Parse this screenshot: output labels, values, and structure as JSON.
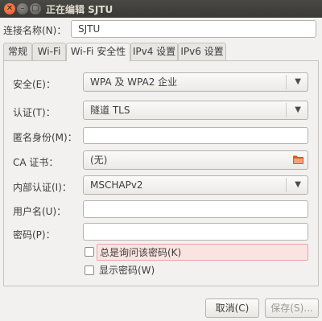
{
  "window": {
    "title": "正在编辑 SJTU",
    "close_glyph": "✕",
    "minimize_glyph": "–",
    "maximize_glyph": "▢"
  },
  "connection_name": {
    "label": "连接名称(N)：",
    "value": "SJTU"
  },
  "tabs": [
    {
      "label": "常规",
      "active": false
    },
    {
      "label": "Wi-Fi",
      "active": false
    },
    {
      "label": "Wi-Fi 安全性",
      "active": true
    },
    {
      "label": "IPv4 设置",
      "active": false
    },
    {
      "label": "IPv6 设置",
      "active": false
    }
  ],
  "security": {
    "security_label": "安全(E)：",
    "security_value": "WPA 及 WPA2 企业",
    "auth_label": "认证(T)：",
    "auth_value": "隧道 TLS",
    "anon_label": "匿名身份(M)：",
    "anon_value": "",
    "ca_label": "CA 证书：",
    "ca_value": "(无)",
    "inner_auth_label": "内部认证(I)：",
    "inner_auth_value": "MSCHAPv2",
    "username_label": "用户名(U)：",
    "username_value": "",
    "password_label": "密码(P)：",
    "password_value": "",
    "always_ask_label": "总是询问该密码(K)",
    "always_ask_checked": false,
    "show_password_label": "显示密码(W)",
    "show_password_checked": false
  },
  "buttons": {
    "cancel": "取消(C)",
    "save": "保存(S)..."
  },
  "icons": {
    "dropdown": "chevron-down-icon",
    "folder": "folder-icon"
  },
  "colors": {
    "titlebar": "#3c3b37",
    "close_button": "#e95420",
    "highlight_bg": "#fbe3e1"
  }
}
